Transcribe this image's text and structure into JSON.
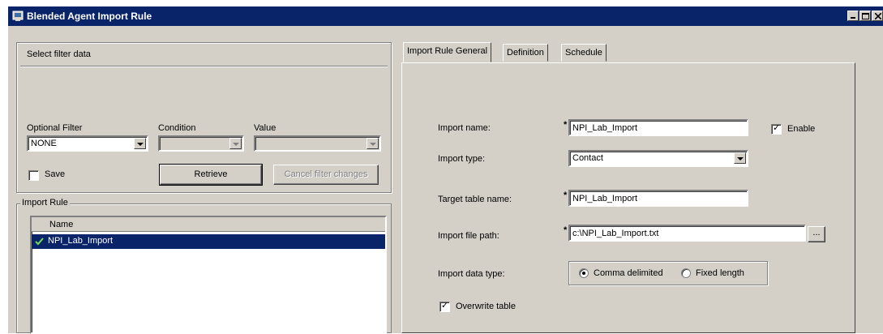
{
  "window": {
    "title": "Blended Agent Import Rule"
  },
  "filter": {
    "header": "Select filter data",
    "optional_filter_label": "Optional Filter",
    "optional_filter_value": "NONE",
    "condition_label": "Condition",
    "condition_value": "",
    "value_label": "Value",
    "value_value": "",
    "save_label": "Save",
    "save_checked": false,
    "retrieve_label": "Retrieve",
    "cancel_label": "Cancel filter changes"
  },
  "import_rule": {
    "group_label": "Import Rule",
    "column_name": "Name",
    "rows": [
      "NPI_Lab_Import"
    ],
    "selected_index": 0
  },
  "tabs": [
    "Import Rule General",
    "Definition",
    "Schedule"
  ],
  "active_tab": 0,
  "general": {
    "import_name_label": "Import name:",
    "import_name_value": "NPI_Lab_Import",
    "enable_label": "Enable",
    "enable_checked": true,
    "import_type_label": "Import type:",
    "import_type_value": "Contact",
    "target_table_label": "Target table name:",
    "target_table_value": "NPI_Lab_Import",
    "file_path_label": "Import file path:",
    "file_path_value": "c:\\NPI_Lab_Import.txt",
    "browse_label": "...",
    "data_type_label": "Import data type:",
    "comma_label": "Comma delimited",
    "fixed_label": "Fixed length",
    "data_type_selected": "comma",
    "overwrite_label": "Overwrite table",
    "overwrite_checked": true,
    "required_marker": "*"
  }
}
